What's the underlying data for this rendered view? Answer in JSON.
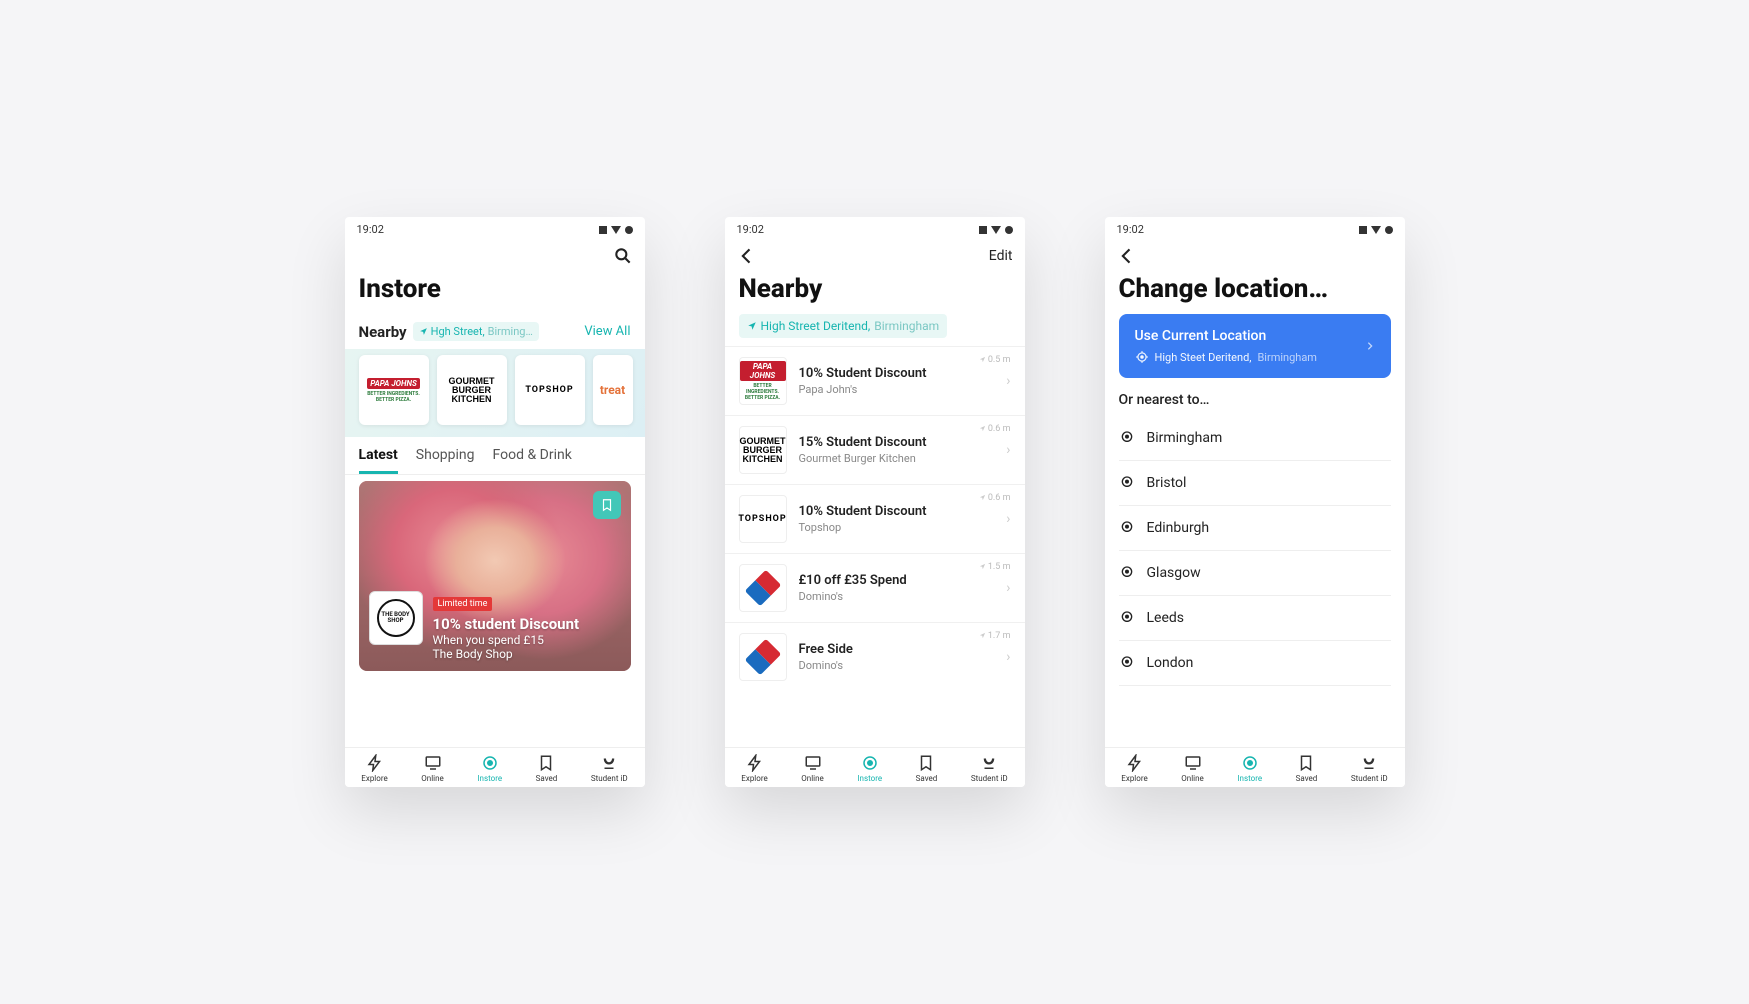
{
  "status": {
    "time": "19:02"
  },
  "nav": {
    "explore": "Explore",
    "online": "Online",
    "instore": "Instore",
    "saved": "Saved",
    "student_id": "Student iD"
  },
  "screen1": {
    "title": "Instore",
    "nearby_label": "Nearby",
    "loc_street": "Hgh Street,",
    "loc_city": "Birming…",
    "view_all": "View All",
    "brands": [
      "PAPA JOHNS",
      "GOURMET BURGER KITCHEN",
      "TOPSHOP",
      "treat"
    ],
    "papa_sub": "BETTER INGREDIENTS. BETTER PIZZA.",
    "tabs": {
      "latest": "Latest",
      "shopping": "Shopping",
      "food": "Food & Drink"
    },
    "promo": {
      "tag": "Limited time",
      "title": "10% student Discount",
      "sub": "When you spend £15",
      "brand": "The Body Shop",
      "logo": "THE BODY SHOP"
    }
  },
  "screen2": {
    "title": "Nearby",
    "edit": "Edit",
    "loc_street": "High Street Deritend,",
    "loc_city": "Birmingham",
    "items": [
      {
        "title": "10% Student Discount",
        "brand": "Papa John's",
        "dist": "0.5 m",
        "logo": "papa"
      },
      {
        "title": "15% Student Discount",
        "brand": "Gourmet Burger Kitchen",
        "dist": "0.6 m",
        "logo": "gbk"
      },
      {
        "title": "10% Student Discount",
        "brand": "Topshop",
        "dist": "0.6 m",
        "logo": "topshop"
      },
      {
        "title": "£10 off £35 Spend",
        "brand": "Domino's",
        "dist": "1.5 m",
        "logo": "dominos"
      },
      {
        "title": "Free Side",
        "brand": "Domino's",
        "dist": "1.7 m",
        "logo": "dominos"
      }
    ]
  },
  "screen3": {
    "title": "Change location…",
    "use_current": "Use Current Location",
    "current_street": "High Steet Deritend,",
    "current_city": "Birmingham",
    "or_nearest": "Or nearest to…",
    "cities": [
      "Birmingham",
      "Bristol",
      "Edinburgh",
      "Glasgow",
      "Leeds",
      "London"
    ]
  }
}
